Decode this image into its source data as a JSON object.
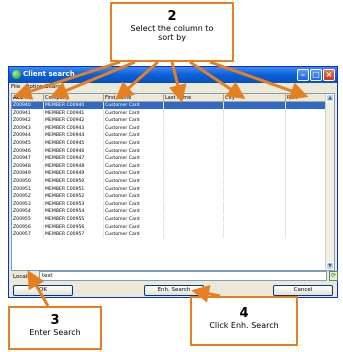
{
  "window": {
    "title": "Client search",
    "menu": [
      "File",
      "Options",
      "Search"
    ],
    "columns": [
      {
        "label": "Acc #",
        "sorted": true
      },
      {
        "label": "Company"
      },
      {
        "label": "First name"
      },
      {
        "label": "Last name"
      },
      {
        "label": "City"
      },
      {
        "label": "Prov"
      }
    ],
    "rows": [
      {
        "acc": "Z00940",
        "company": "MEMBER C00940",
        "first": "Customer Card",
        "selected": true
      },
      {
        "acc": "Z00941",
        "company": "MEMBER C00941",
        "first": "Customer Card"
      },
      {
        "acc": "Z00942",
        "company": "MEMBER C00942",
        "first": "Customer Card"
      },
      {
        "acc": "Z00943",
        "company": "MEMBER C00943",
        "first": "Customer Card"
      },
      {
        "acc": "Z00944",
        "company": "MEMBER C00944",
        "first": "Customer Card"
      },
      {
        "acc": "Z00945",
        "company": "MEMBER C00945",
        "first": "Customer Card"
      },
      {
        "acc": "Z00946",
        "company": "MEMBER C00946",
        "first": "Customer Card"
      },
      {
        "acc": "Z00947",
        "company": "MEMBER C00947",
        "first": "Customer Card"
      },
      {
        "acc": "Z00948",
        "company": "MEMBER C00948",
        "first": "Customer Card"
      },
      {
        "acc": "Z00949",
        "company": "MEMBER C00949",
        "first": "Customer Card"
      },
      {
        "acc": "Z00950",
        "company": "MEMBER C00950",
        "first": "Customer Card"
      },
      {
        "acc": "Z00951",
        "company": "MEMBER C00951",
        "first": "Customer Card"
      },
      {
        "acc": "Z00952",
        "company": "MEMBER C00952",
        "first": "Customer Card"
      },
      {
        "acc": "Z00953",
        "company": "MEMBER C00953",
        "first": "Customer Card"
      },
      {
        "acc": "Z00954",
        "company": "MEMBER C00954",
        "first": "Customer Card"
      },
      {
        "acc": "Z00955",
        "company": "MEMBER C00955",
        "first": "Customer Card"
      },
      {
        "acc": "Z00956",
        "company": "MEMBER C00956",
        "first": "Customer Card"
      },
      {
        "acc": "Z00957",
        "company": "MEMBER C00957",
        "first": "Customer Card"
      }
    ],
    "locale_label": "Locale",
    "locale_value": "test",
    "buttons": {
      "ok": "OK",
      "enh_search": "Enh. Search",
      "cancel": "Cancel"
    }
  },
  "callouts": {
    "sort": {
      "number": "2",
      "text": "Select the column  to sort by"
    },
    "enter": {
      "number": "3",
      "text": "Enter Search"
    },
    "click": {
      "number": "4",
      "text": "Click Enh. Search"
    }
  },
  "colors": {
    "accent": "#e67e22",
    "selection": "#316ac5",
    "title_bar": "#0a5fd6"
  }
}
